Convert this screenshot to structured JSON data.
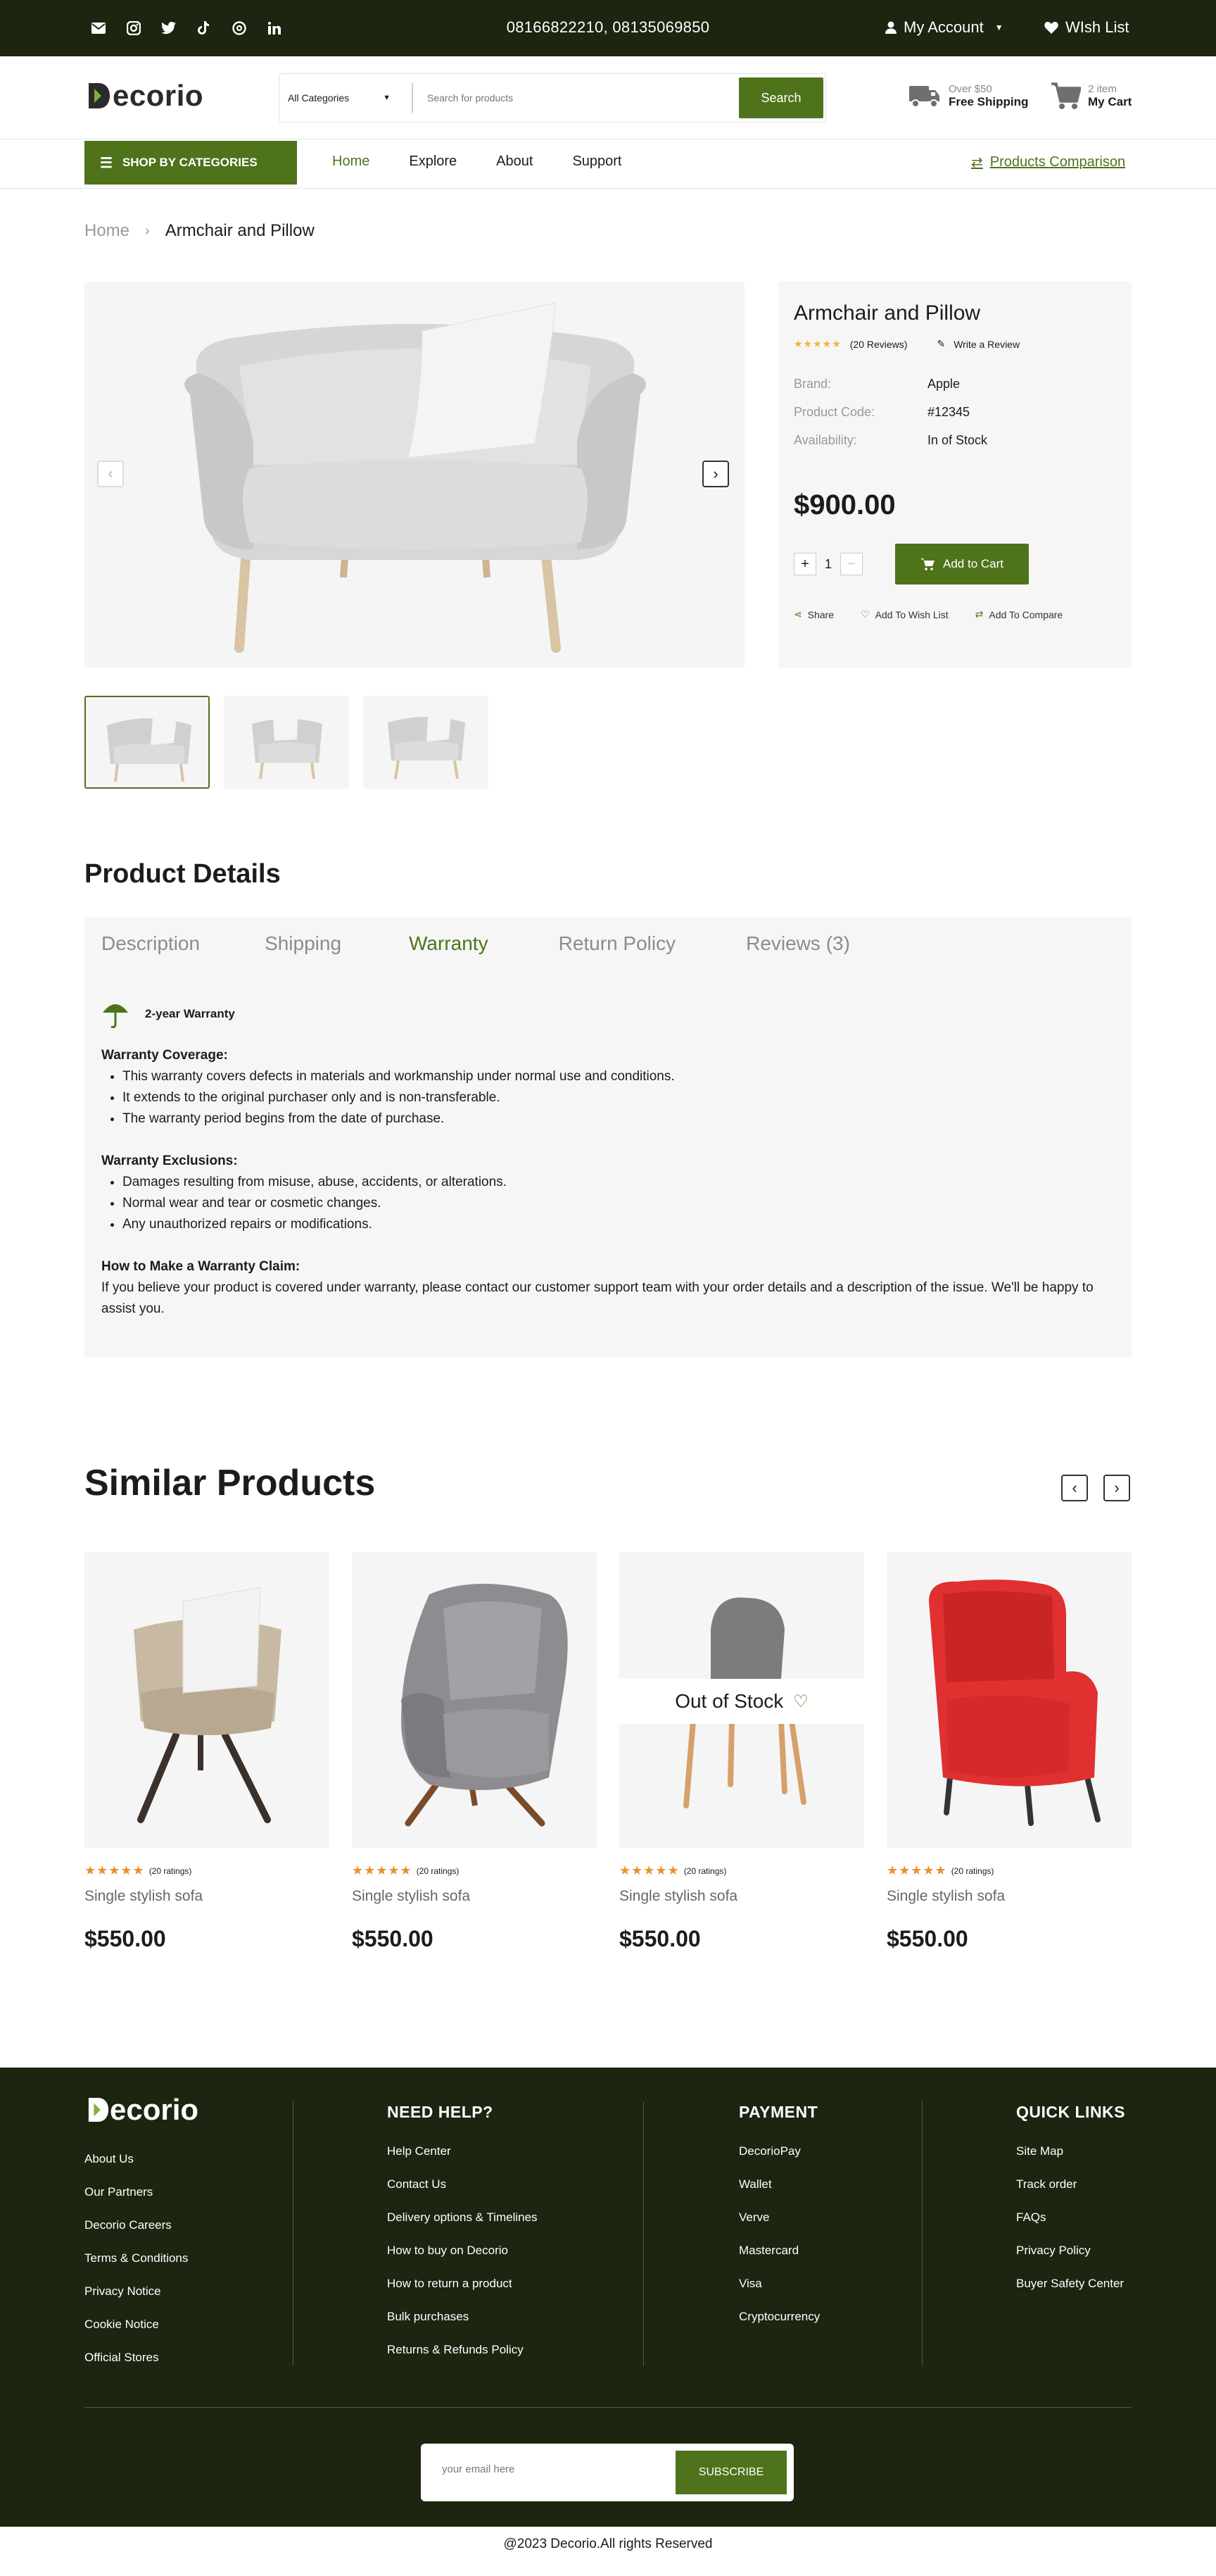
{
  "topbar": {
    "phones": "08166822210,  08135069850",
    "account_label": "My Account",
    "wishlist_label": "WIsh List",
    "social_icons": [
      "mail-icon",
      "instagram-icon",
      "twitter-icon",
      "tiktok-icon",
      "threads-icon",
      "linkedin-icon"
    ]
  },
  "header": {
    "logo": "ecorio",
    "category_select": "All Categories",
    "search_placeholder": "Search for products",
    "search_button": "Search",
    "shipping_small": "Over $50",
    "shipping_big": "Free Shipping",
    "cart_small": "2 item",
    "cart_big": "My Cart"
  },
  "nav": {
    "categories_button": "SHOP BY CATEGORIES",
    "links": [
      "Home",
      "Explore",
      "About",
      "Support"
    ],
    "active": "Home",
    "compare": "Products Comparison"
  },
  "breadcrumb": {
    "home": "Home",
    "current": "Armchair and Pillow"
  },
  "product": {
    "title": "Armchair and Pillow",
    "stars": "★★★★★",
    "reviews": "(20 Reviews)",
    "write_review": "Write a Review",
    "brand_label": "Brand:",
    "brand": "Apple",
    "code_label": "Product Code:",
    "code": "#12345",
    "availability_label": "Availability:",
    "availability": "In of Stock",
    "price": "$900.00",
    "quantity": "1",
    "add_to_cart": "Add to Cart",
    "share": "Share",
    "wishlist": "Add To Wish List",
    "compare": "Add To Compare"
  },
  "details": {
    "heading": "Product Details",
    "tabs": [
      "Description",
      "Shipping",
      "Warranty",
      "Return Policy",
      "Reviews (3)"
    ],
    "active_tab": "Warranty",
    "warranty_title": "2-year Warranty",
    "coverage_heading": "Warranty Coverage:",
    "coverage": [
      "This warranty covers defects in materials and workmanship under normal use and conditions.",
      "It extends to the original purchaser only and is non-transferable.",
      "The warranty period begins from the date of purchase."
    ],
    "exclusions_heading": "Warranty Exclusions:",
    "exclusions": [
      "Damages resulting from misuse, abuse, accidents, or alterations.",
      "Normal wear and tear or cosmetic changes.",
      "Any unauthorized repairs or modifications."
    ],
    "claim_heading": "How to Make a Warranty Claim:",
    "claim_text": "If you believe your product is covered under warranty, please contact our customer support team with your order details and a description of the issue. We'll be happy to assist you."
  },
  "similar": {
    "heading": "Similar Products",
    "out_of_stock": "Out of Stock",
    "items": [
      {
        "stars": "★★★★★",
        "ratings": "(20 ratings)",
        "name": "Single stylish sofa",
        "price": "$550.00"
      },
      {
        "stars": "★★★★★",
        "ratings": "(20 ratings)",
        "name": "Single stylish sofa",
        "price": "$550.00"
      },
      {
        "stars": "★★★★★",
        "ratings": "(20 ratings)",
        "name": "Single stylish sofa",
        "price": "$550.00"
      },
      {
        "stars": "★★★★★",
        "ratings": "(20 ratings)",
        "name": "Single stylish sofa",
        "price": "$550.00"
      }
    ]
  },
  "footer": {
    "logo": "ecorio",
    "col1": [
      "About Us",
      "Our Partners",
      "Decorio Careers",
      "Terms & Conditions",
      "Privacy Notice",
      "Cookie Notice",
      "Official Stores"
    ],
    "help_heading": "NEED HELP?",
    "help": [
      "Help Center",
      "Contact Us",
      "Delivery options & Timelines",
      "How to buy on Decorio",
      "How to return a product",
      "Bulk purchases",
      "Returns & Refunds Policy"
    ],
    "payment_heading": "PAYMENT",
    "payment": [
      "DecorioPay",
      "Wallet",
      "Verve",
      "Mastercard",
      "Visa",
      "Cryptocurrency"
    ],
    "quick_heading": "QUICK LINKS",
    "quick": [
      "Site Map",
      "Track order",
      "FAQs",
      "Privacy Policy",
      "Buyer Safety Center"
    ],
    "email_placeholder": "your email here",
    "subscribe": "SUBSCRIBE",
    "copyright": "@2023 Decorio.All rights Reserved"
  },
  "colors": {
    "brand_green": "#4f731b",
    "dark_bg": "#1d240f",
    "star_yellow": "#f0b33a",
    "red_chair": "#e03030"
  }
}
